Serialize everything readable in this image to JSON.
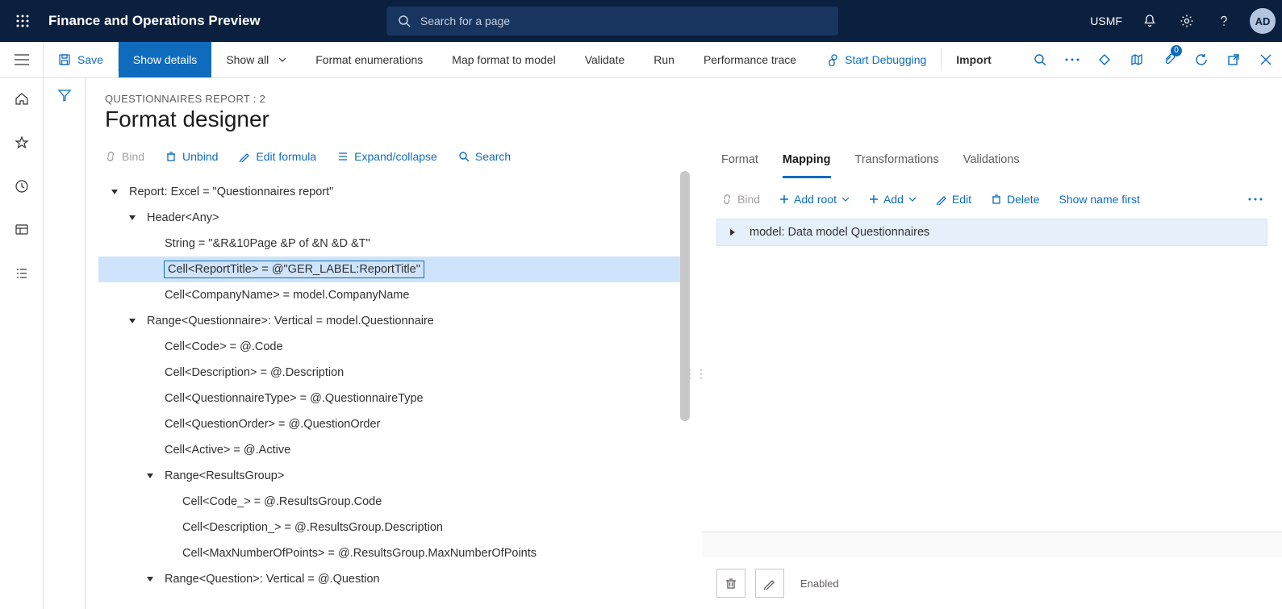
{
  "topbar": {
    "app_title": "Finance and Operations Preview",
    "search_placeholder": "Search for a page",
    "company": "USMF",
    "avatar": "AD"
  },
  "cmdbar": {
    "save": "Save",
    "show_details": "Show details",
    "show_all": "Show all",
    "format_enum": "Format enumerations",
    "map_format": "Map format to model",
    "validate": "Validate",
    "run": "Run",
    "perf_trace": "Performance trace",
    "start_debug": "Start Debugging",
    "import": "Import",
    "attach_badge": "0"
  },
  "page": {
    "breadcrumb": "QUESTIONNAIRES REPORT : 2",
    "title": "Format designer"
  },
  "toolbar2": {
    "bind": "Bind",
    "unbind": "Unbind",
    "edit_formula": "Edit formula",
    "expand": "Expand/collapse",
    "search": "Search"
  },
  "tree": [
    {
      "indent": 0,
      "caret": "down",
      "label": "Report: Excel = \"Questionnaires report\""
    },
    {
      "indent": 1,
      "caret": "down",
      "label": "Header<Any>"
    },
    {
      "indent": 2,
      "caret": "",
      "label": "String = \"&R&10Page &P of &N &D &T\""
    },
    {
      "indent": 2,
      "caret": "",
      "label": "Cell<ReportTitle> = @\"GER_LABEL:ReportTitle\"",
      "selected": true
    },
    {
      "indent": 2,
      "caret": "",
      "label": "Cell<CompanyName> = model.CompanyName"
    },
    {
      "indent": 1,
      "caret": "down",
      "label": "Range<Questionnaire>: Vertical = model.Questionnaire"
    },
    {
      "indent": 2,
      "caret": "",
      "label": "Cell<Code> = @.Code"
    },
    {
      "indent": 2,
      "caret": "",
      "label": "Cell<Description> = @.Description"
    },
    {
      "indent": 2,
      "caret": "",
      "label": "Cell<QuestionnaireType> = @.QuestionnaireType"
    },
    {
      "indent": 2,
      "caret": "",
      "label": "Cell<QuestionOrder> = @.QuestionOrder"
    },
    {
      "indent": 2,
      "caret": "",
      "label": "Cell<Active> = @.Active"
    },
    {
      "indent": 2,
      "caret": "down",
      "label": "Range<ResultsGroup>"
    },
    {
      "indent": 3,
      "caret": "",
      "label": "Cell<Code_> = @.ResultsGroup.Code"
    },
    {
      "indent": 3,
      "caret": "",
      "label": "Cell<Description_> = @.ResultsGroup.Description"
    },
    {
      "indent": 3,
      "caret": "",
      "label": "Cell<MaxNumberOfPoints> = @.ResultsGroup.MaxNumberOfPoints"
    },
    {
      "indent": 2,
      "caret": "down",
      "label": "Range<Question>: Vertical = @.Question"
    }
  ],
  "tabs": {
    "format": "Format",
    "mapping": "Mapping",
    "transformations": "Transformations",
    "validations": "Validations"
  },
  "rtoolbar": {
    "bind": "Bind",
    "add_root": "Add root",
    "add": "Add",
    "edit": "Edit",
    "delete": "Delete",
    "show_name": "Show name first"
  },
  "model_row": "model: Data model Questionnaires",
  "bottom": {
    "enabled_label": "Enabled"
  }
}
